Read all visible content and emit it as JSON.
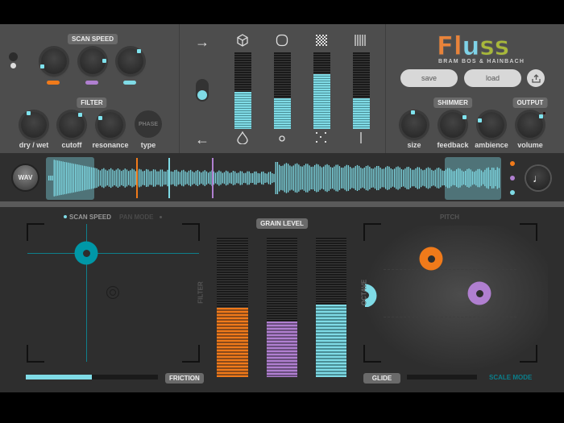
{
  "app": {
    "logo": "Fluss",
    "credit": "BRAM BOS & HAINBACH"
  },
  "colors": {
    "orange": "#f07a1a",
    "purple": "#b07fd0",
    "cyan": "#7fdbe6",
    "teal": "#0097a7"
  },
  "scan_speed": {
    "label": "SCAN SPEED"
  },
  "filter": {
    "label": "FILTER",
    "knobs": [
      "dry / wet",
      "cutoff",
      "resonance",
      "type"
    ],
    "phase_label": "PHASE"
  },
  "envelope": {
    "meters": [
      {
        "top_icon": "cube-icon",
        "bottom_icon": "drop-icon",
        "level": 0.48
      },
      {
        "top_icon": "rounded-square-icon",
        "bottom_icon": "small-circle-icon",
        "level": 0.4
      },
      {
        "top_icon": "checker-icon",
        "bottom_icon": "dots-icon",
        "level": 0.72
      },
      {
        "top_icon": "bars-icon",
        "bottom_icon": "line-icon",
        "level": 0.4
      }
    ]
  },
  "presets": {
    "save": "save",
    "load": "load"
  },
  "shimmer": {
    "label": "SHIMMER",
    "knobs": [
      "size",
      "feedback",
      "ambience"
    ]
  },
  "output": {
    "label": "OUTPUT",
    "knob": "volume"
  },
  "waveform": {
    "wav_button": "WAV"
  },
  "scan_pad": {
    "mode_active": "SCAN SPEED",
    "mode_inactive": "PAN MODE",
    "axis_label": "FILTER",
    "friction_label": "FRICTION",
    "friction": 0.5
  },
  "grain": {
    "label": "GRAIN LEVEL",
    "levels": [
      0.5,
      0.4,
      0.52
    ]
  },
  "pitch_pad": {
    "label": "PITCH",
    "axis_label": "OCTAVE",
    "glide_label": "GLIDE",
    "glide": 0,
    "scale_mode": "SCALE MODE"
  }
}
